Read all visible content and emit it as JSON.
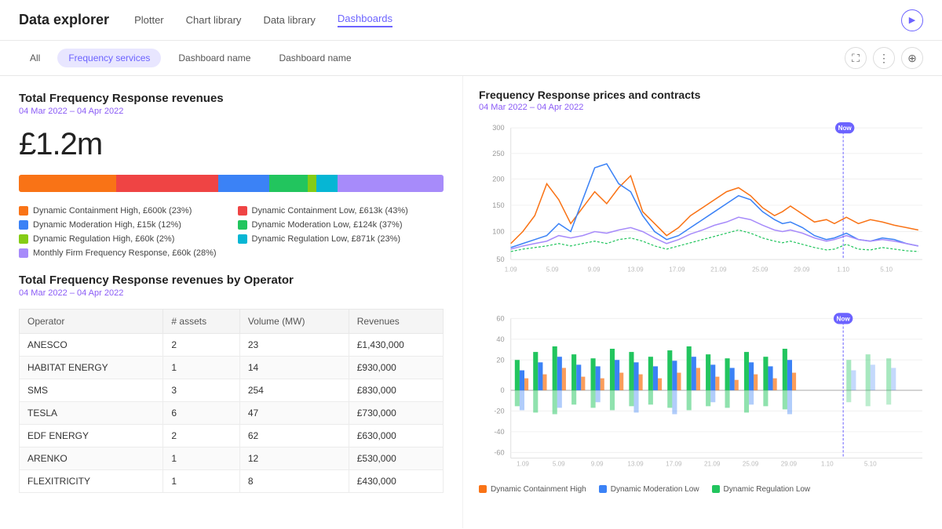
{
  "header": {
    "title": "Data explorer",
    "nav": [
      {
        "label": "Plotter",
        "active": false
      },
      {
        "label": "Chart library",
        "active": false
      },
      {
        "label": "Data library",
        "active": false
      },
      {
        "label": "Dashboards",
        "active": true
      }
    ],
    "play_icon": "▶"
  },
  "tabs": {
    "items": [
      {
        "label": "All",
        "active": false
      },
      {
        "label": "Frequency services",
        "active": true
      },
      {
        "label": "Dashboard name",
        "active": false
      },
      {
        "label": "Dashboard name",
        "active": false
      }
    ],
    "icons": [
      "⛶",
      "⋮",
      "⊕"
    ]
  },
  "left": {
    "section1": {
      "title": "Total Frequency Response revenues",
      "date": "04 Mar 2022 – 04 Apr 2022",
      "amount": "£1.2m",
      "bar_segments": [
        {
          "color": "#f97316",
          "width": 23
        },
        {
          "color": "#ef4444",
          "width": 43
        },
        {
          "color": "#3b82f6",
          "width": 12
        },
        {
          "color": "#22c55e",
          "width": 8
        },
        {
          "color": "#84cc16",
          "width": 2
        },
        {
          "color": "#06b6d4",
          "width": 5
        },
        {
          "color": "#a78bfa",
          "width": 7
        }
      ],
      "legend": [
        {
          "color": "#f97316",
          "label": "Dynamic Containment High, £600k (23%)"
        },
        {
          "color": "#ef4444",
          "label": "Dynamic Containment Low, £613k (43%)"
        },
        {
          "color": "#3b82f6",
          "label": "Dynamic Moderation High, £15k (12%)"
        },
        {
          "color": "#22c55e",
          "label": "Dynamic Moderation Low, £124k (37%)"
        },
        {
          "color": "#84cc16",
          "label": "Dynamic Regulation High, £60k (2%)"
        },
        {
          "color": "#06b6d4",
          "label": "Dynamic Regulation Low, £871k (23%)"
        },
        {
          "color": "#a78bfa",
          "label": "Monthly Firm Frequency Response, £60k (28%)"
        }
      ]
    },
    "section2": {
      "title": "Total Frequency Response revenues by Operator",
      "date": "04 Mar 2022 – 04 Apr 2022",
      "table": {
        "headers": [
          "Operator",
          "# assets",
          "Volume (MW)",
          "Revenues"
        ],
        "rows": [
          [
            "ANESCO",
            "2",
            "23",
            "£1,430,000"
          ],
          [
            "HABITAT ENERGY",
            "1",
            "14",
            "£930,000"
          ],
          [
            "SMS",
            "3",
            "254",
            "£830,000"
          ],
          [
            "TESLA",
            "6",
            "47",
            "£730,000"
          ],
          [
            "EDF ENERGY",
            "2",
            "62",
            "£630,000"
          ],
          [
            "ARENKO",
            "1",
            "12",
            "£530,000"
          ],
          [
            "FLEXITRICITY",
            "1",
            "8",
            "£430,000"
          ]
        ]
      }
    }
  },
  "right": {
    "section1": {
      "title": "Frequency Response prices and contracts",
      "date": "04 Mar 2022 – 04 Apr 2022",
      "now_label": "Now",
      "y_labels": [
        "300",
        "250",
        "200",
        "150",
        "100",
        "50"
      ],
      "x_labels": [
        "1.09",
        "5.09",
        "9.09",
        "13.09",
        "17.09",
        "21.09",
        "25.09",
        "29.09",
        "1.10",
        "5.10"
      ]
    },
    "section2": {
      "now_label": "Now",
      "y_labels": [
        "60",
        "40",
        "20",
        "0",
        "-20",
        "-40",
        "-60"
      ],
      "x_labels": [
        "1.09",
        "5.09",
        "9.09",
        "13.09",
        "17.09",
        "21.09",
        "25.09",
        "29.09",
        "1.10",
        "5.10"
      ]
    },
    "legend": [
      {
        "color": "#f97316",
        "label": "Dynamic Containment High"
      },
      {
        "color": "#3b82f6",
        "label": "Dynamic Moderation Low"
      },
      {
        "color": "#22c55e",
        "label": "Dynamic Regulation Low"
      }
    ]
  }
}
